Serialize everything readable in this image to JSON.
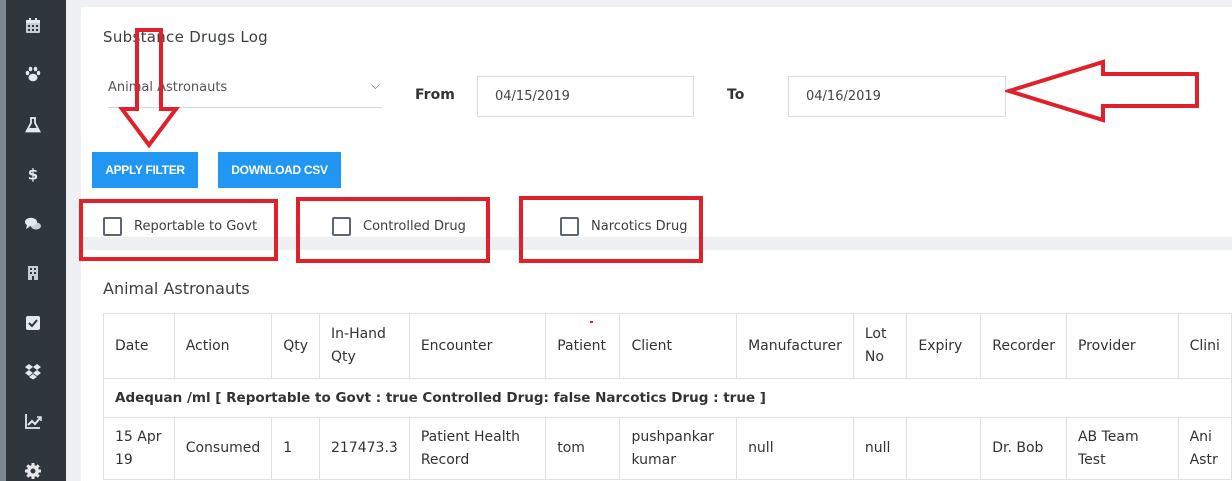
{
  "sidebar": {
    "icons": [
      "calendar-icon",
      "paw-icon",
      "flask-icon",
      "dollar-icon",
      "comments-icon",
      "building-icon",
      "check-square-icon",
      "dropbox-icon",
      "chart-line-icon",
      "gear-icon"
    ]
  },
  "page": {
    "title": "Substance Drugs Log"
  },
  "filters": {
    "clinic_value": "Animal Astronauts",
    "from_label": "From",
    "from_value": "04/15/2019",
    "to_label": "To",
    "to_value": "04/16/2019",
    "apply_label": "APPLY FILTER",
    "download_label": "DOWNLOAD CSV",
    "checkboxes": [
      {
        "label": "Reportable to Govt",
        "checked": false
      },
      {
        "label": "Controlled Drug",
        "checked": false
      },
      {
        "label": "Narcotics Drug",
        "checked": false
      }
    ]
  },
  "report": {
    "clinic_title": "Animal Astronauts",
    "columns": [
      {
        "line1": "Date",
        "line2": ""
      },
      {
        "line1": "Action",
        "line2": ""
      },
      {
        "line1": "Qty",
        "line2": ""
      },
      {
        "line1": "In-Hand",
        "line2": "Qty"
      },
      {
        "line1": "Encounter",
        "line2": ""
      },
      {
        "line1": "Patient",
        "line2": ""
      },
      {
        "line1": "Client",
        "line2": ""
      },
      {
        "line1": "Manufacturer",
        "line2": ""
      },
      {
        "line1": "Lot",
        "line2": "No"
      },
      {
        "line1": "Expiry",
        "line2": ""
      },
      {
        "line1": "Recorder",
        "line2": ""
      },
      {
        "line1": "Provider",
        "line2": ""
      },
      {
        "line1": "Clini",
        "line2": ""
      }
    ],
    "group_header": "Adequan /ml [ Reportable to Govt : true Controlled Drug: false Narcotics Drug : true ]",
    "rows": [
      {
        "date_l1": "15 Apr",
        "date_l2": "19",
        "action": "Consumed",
        "qty": "1",
        "in_hand": "217473.3",
        "encounter_l1": "Patient Health",
        "encounter_l2": "Record",
        "patient": "tom",
        "client_l1": "pushpankar",
        "client_l2": "kumar",
        "manufacturer": "null",
        "lot": "null",
        "expiry": "",
        "recorder": "Dr. Bob",
        "provider": "AB Team Test",
        "clinic_l1": "Ani",
        "clinic_l2": "Astr"
      }
    ]
  },
  "colors": {
    "sidebar_bg": "#2f363c",
    "accent": "#2196f3",
    "annotation_red": "#e0202a"
  }
}
